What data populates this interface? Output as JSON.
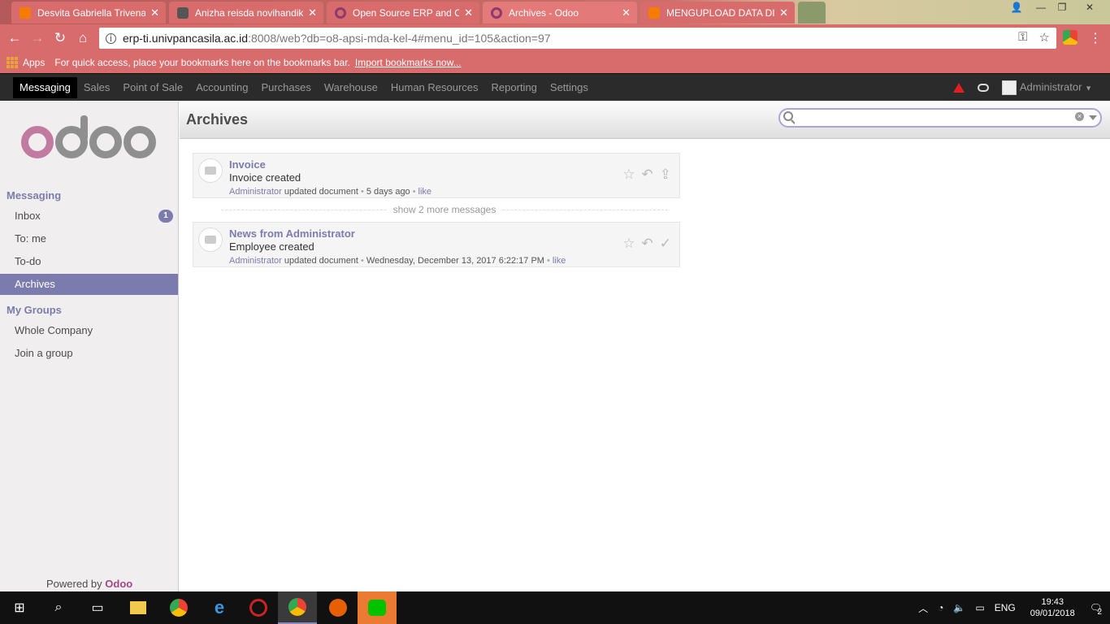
{
  "browser": {
    "tabs": [
      {
        "title": "Desvita Gabriella Trivena",
        "color": "#f57c00"
      },
      {
        "title": "Anizha reisda novihandik",
        "color": "#555555"
      },
      {
        "title": "Open Source ERP and CR",
        "color": "#8f3a6e"
      },
      {
        "title": "Archives - Odoo",
        "color": "#8f3a6e",
        "active": true
      },
      {
        "title": "MENGUPLOAD DATA DI",
        "color": "#f57c00"
      }
    ],
    "url_host": "erp-ti.univpancasila.ac.id",
    "url_path": ":8008/web?db=o8-apsi-mda-kel-4#menu_id=105&action=97",
    "bookmarks": {
      "apps": "Apps",
      "hint": "For quick access, place your bookmarks here on the bookmarks bar.",
      "import": "Import bookmarks now..."
    }
  },
  "odoo_nav": {
    "menus": [
      "Messaging",
      "Sales",
      "Point of Sale",
      "Accounting",
      "Purchases",
      "Warehouse",
      "Human Resources",
      "Reporting",
      "Settings"
    ],
    "user": "Administrator"
  },
  "sidebar": {
    "logo": "odoo",
    "section1": "Messaging",
    "items": [
      {
        "label": "Inbox",
        "badge": "1"
      },
      {
        "label": "To: me"
      },
      {
        "label": "To-do"
      },
      {
        "label": "Archives",
        "active": true
      }
    ],
    "section2": "My Groups",
    "groups": [
      {
        "label": "Whole Company"
      },
      {
        "label": "Join a group"
      }
    ],
    "powered_prefix": "Powered by",
    "powered_brand": "Odoo"
  },
  "main": {
    "title": "Archives",
    "search_value": "",
    "messages": [
      {
        "subject": "Invoice",
        "body": "Invoice created",
        "author": "Administrator",
        "action": "updated document",
        "time": "5 days ago",
        "like": "like"
      },
      {
        "subject": "News from Administrator",
        "body": "Employee created",
        "author": "Administrator",
        "action": "updated document",
        "time": "Wednesday, December 13, 2017 6:22:17 PM",
        "like": "like"
      }
    ],
    "show_more": "show 2 more messages"
  },
  "taskbar": {
    "lang": "ENG",
    "time": "19:43",
    "date": "09/01/2018",
    "notifications": "2"
  }
}
